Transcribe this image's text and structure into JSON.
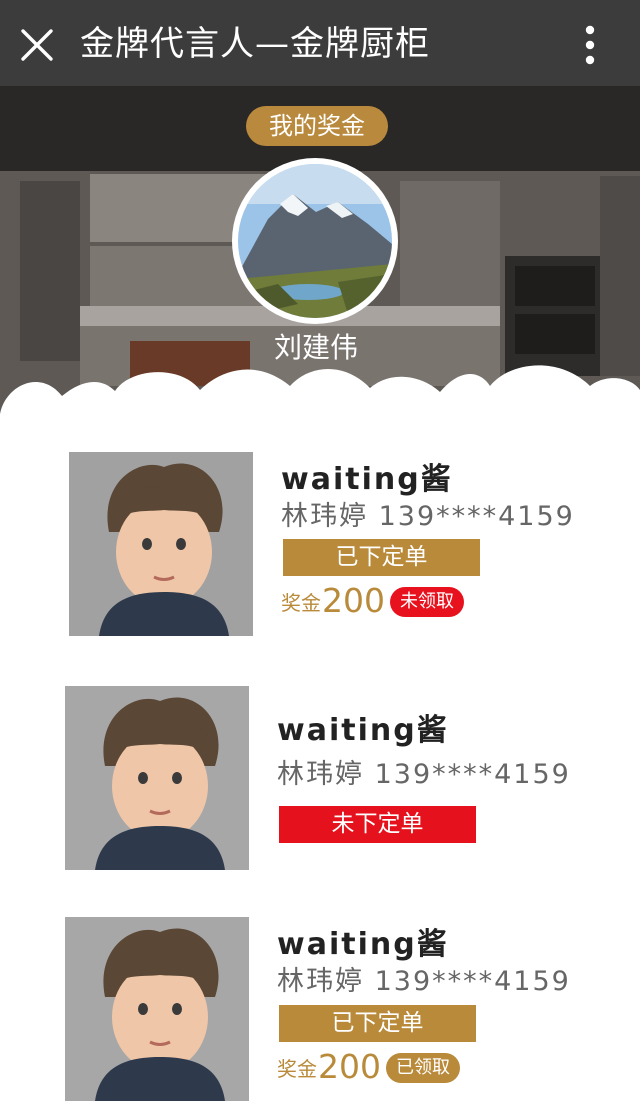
{
  "titlebar": {
    "title": "金牌代言人—金牌厨柜",
    "close_icon": "close-icon",
    "more_icon": "more-vertical-icon"
  },
  "header": {
    "badge": "我的奖金",
    "user_name": "刘建伟",
    "avatar_icon": "mountain-landscape-avatar"
  },
  "colors": {
    "topbar": "#3c3c3c",
    "gold": "#b88a3a",
    "red": "#e5121d"
  },
  "referrals": [
    {
      "nickname": "waiting酱",
      "contact": "林玮婷 139****4159",
      "status": "已下定单",
      "status_type": "done",
      "bonus_label": "奖金",
      "bonus_amount": "200",
      "claim": "未领取"
    },
    {
      "nickname": "waiting酱",
      "contact": "林玮婷 139****4159",
      "status": "未下定单",
      "status_type": "none"
    },
    {
      "nickname": "waiting酱",
      "contact": "林玮婷 139****4159",
      "status": "已下定单",
      "status_type": "done",
      "bonus_label": "奖金",
      "bonus_amount": "200",
      "claim": "已领取"
    }
  ]
}
